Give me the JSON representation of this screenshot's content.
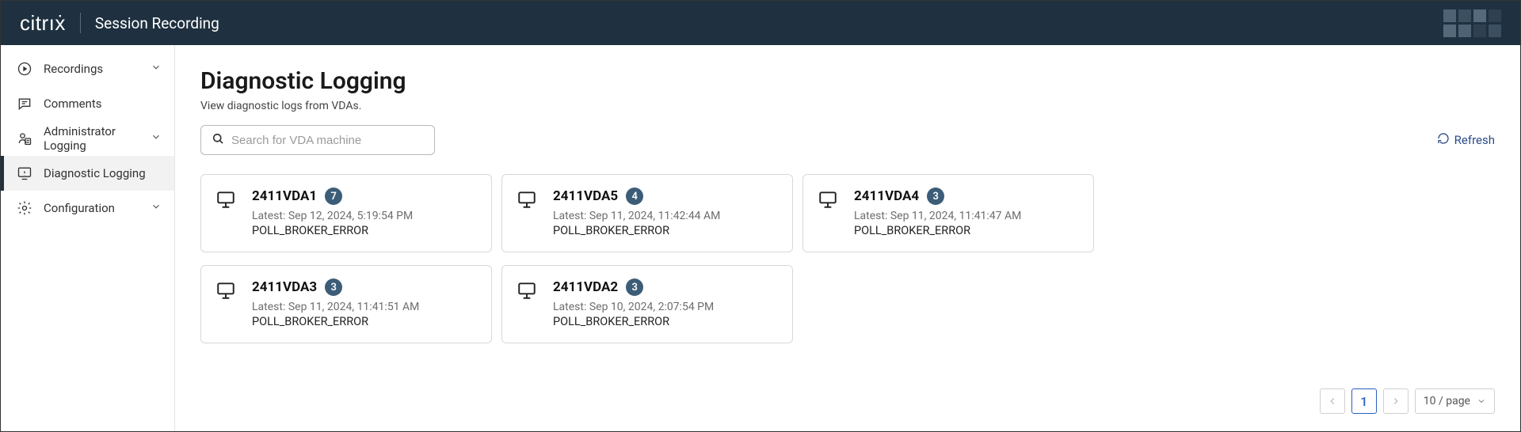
{
  "header": {
    "brand": "citrıẋ",
    "product": "Session Recording"
  },
  "sidebar": {
    "items": [
      {
        "label": "Recordings",
        "icon": "play-circle-icon",
        "expandable": true
      },
      {
        "label": "Comments",
        "icon": "comment-icon",
        "expandable": false
      },
      {
        "label": "Administrator Logging",
        "icon": "admin-log-icon",
        "expandable": true
      },
      {
        "label": "Diagnostic Logging",
        "icon": "diagnostic-icon",
        "expandable": false,
        "active": true
      },
      {
        "label": "Configuration",
        "icon": "gear-icon",
        "expandable": true
      }
    ]
  },
  "page": {
    "title": "Diagnostic Logging",
    "subtitle": "View diagnostic logs from VDAs.",
    "search_placeholder": "Search for VDA machine",
    "refresh_label": "Refresh"
  },
  "machines": [
    {
      "name": "2411VDA1",
      "count": 7,
      "latest": "Latest: Sep 12, 2024, 5:19:54 PM",
      "error": "POLL_BROKER_ERROR"
    },
    {
      "name": "2411VDA5",
      "count": 4,
      "latest": "Latest: Sep 11, 2024, 11:42:44 AM",
      "error": "POLL_BROKER_ERROR"
    },
    {
      "name": "2411VDA4",
      "count": 3,
      "latest": "Latest: Sep 11, 2024, 11:41:47 AM",
      "error": "POLL_BROKER_ERROR"
    },
    {
      "name": "2411VDA3",
      "count": 3,
      "latest": "Latest: Sep 11, 2024, 11:41:51 AM",
      "error": "POLL_BROKER_ERROR"
    },
    {
      "name": "2411VDA2",
      "count": 3,
      "latest": "Latest: Sep 10, 2024, 2:07:54 PM",
      "error": "POLL_BROKER_ERROR"
    }
  ],
  "pagination": {
    "current": "1",
    "size_label": "10 / page"
  }
}
